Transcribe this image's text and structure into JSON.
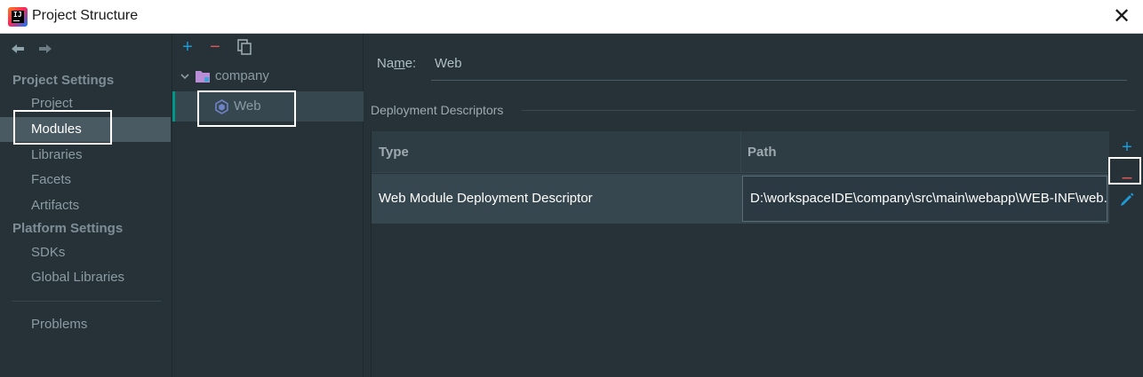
{
  "window": {
    "title": "Project Structure",
    "close_glyph": "✕",
    "app_icon_text": "IJ"
  },
  "colors": {
    "accent_teal": "#009688",
    "add_blue": "#1e9bd7",
    "remove_red": "#e05555",
    "selected_bg": "#4a5a63",
    "background": "#263238"
  },
  "leftnav": {
    "back_icon": "arrow-left-icon",
    "forward_icon": "arrow-right-icon",
    "project_settings_header": "Project Settings",
    "project_settings_items": [
      {
        "label": "Project"
      },
      {
        "label": "Modules"
      },
      {
        "label": "Libraries"
      },
      {
        "label": "Facets"
      },
      {
        "label": "Artifacts"
      }
    ],
    "platform_settings_header": "Platform Settings",
    "platform_settings_items": [
      {
        "label": "SDKs"
      },
      {
        "label": "Global Libraries"
      }
    ],
    "problems_label": "Problems",
    "selected": "Modules"
  },
  "tree": {
    "toolbar": {
      "add_glyph": "+",
      "remove_glyph": "−",
      "copy_icon": "copy-icon"
    },
    "root": {
      "label": "company",
      "icon": "folder-icon",
      "expanded": true
    },
    "child": {
      "label": "Web",
      "icon": "web-module-icon",
      "selected": true
    }
  },
  "detail": {
    "name_label_pre": "Na",
    "name_label_mnemonic": "m",
    "name_label_post": "e:",
    "name_value": "Web",
    "group_title": "Deployment Descriptors",
    "table": {
      "columns": [
        "Type",
        "Path"
      ],
      "rows": [
        {
          "type": "Web Module Deployment Descriptor",
          "path": "D:\\workspaceIDE\\company\\src\\main\\webapp\\WEB-INF\\web.xml"
        }
      ]
    },
    "side_tools": {
      "add_glyph": "+",
      "remove_glyph": "−",
      "edit_icon": "pencil-icon"
    }
  }
}
